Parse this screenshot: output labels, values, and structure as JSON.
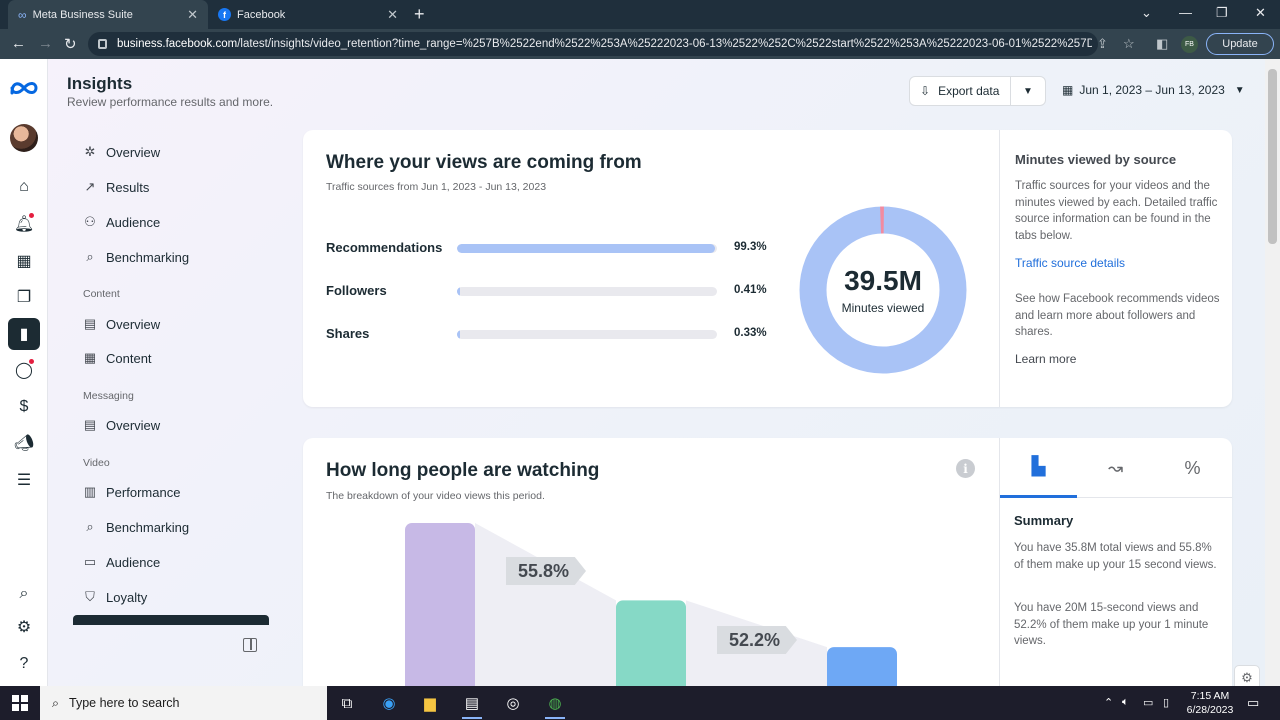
{
  "browser": {
    "tabs": [
      {
        "title": "Meta Business Suite",
        "active": true
      },
      {
        "title": "Facebook",
        "active": false
      }
    ],
    "url_domain": "business.facebook.com",
    "url_path": "/latest/insights/video_retention?time_range=%257B%2522end%2522%253A%25222023-06-13%2522%252C%2522start%2522%253A%25222023-06-01%2522%257D",
    "profile_initials": "FB",
    "update_label": "Update"
  },
  "header": {
    "title": "Insights",
    "subtitle": "Review performance results and more.",
    "export_label": "Export data",
    "date_range": "Jun 1, 2023 – Jun 13, 2023"
  },
  "subnav": {
    "items": [
      {
        "label": "Overview",
        "icon": "network-icon"
      },
      {
        "label": "Results",
        "icon": "trend-icon"
      },
      {
        "label": "Audience",
        "icon": "people-icon"
      },
      {
        "label": "Benchmarking",
        "icon": "benchmark-icon"
      }
    ],
    "content_section": "Content",
    "content_items": [
      {
        "label": "Overview",
        "icon": "overview-icon"
      },
      {
        "label": "Content",
        "icon": "table-icon"
      }
    ],
    "messaging_section": "Messaging",
    "messaging_items": [
      {
        "label": "Overview",
        "icon": "overview-icon"
      }
    ],
    "video_section": "Video",
    "video_items": [
      {
        "label": "Performance",
        "icon": "document-icon"
      },
      {
        "label": "Benchmarking",
        "icon": "benchmark-icon"
      },
      {
        "label": "Audience",
        "icon": "camera-icon"
      },
      {
        "label": "Loyalty",
        "icon": "shield-icon"
      }
    ]
  },
  "views_card": {
    "title": "Where your views are coming from",
    "subtitle": "Traffic sources from Jun 1, 2023 - Jun 13, 2023",
    "sources": [
      {
        "label": "Recommendations",
        "value": 99.3,
        "display": "99.3%"
      },
      {
        "label": "Followers",
        "value": 0.41,
        "display": "0.41%"
      },
      {
        "label": "Shares",
        "value": 0.33,
        "display": "0.33%"
      }
    ],
    "donut_value": "39.5M",
    "donut_label": "Minutes viewed",
    "side_title": "Minutes viewed by source",
    "side_text_1": "Traffic sources for your videos and the minutes viewed by each. Detailed traffic source information can be found in the tabs below.",
    "side_link_1": "Traffic source details",
    "side_text_2": "See how Facebook recommends videos and learn more about followers and shares.",
    "side_link_2": "Learn more",
    "colors": {
      "primary": "#a9c3f6",
      "accent": "#f28ba0"
    }
  },
  "watch_card": {
    "title": "How long people are watching",
    "subtitle": "The breakdown of your video views this period.",
    "bars": [
      {
        "color": "#c7b9e6",
        "value": 100
      },
      {
        "color": "#86d9c6",
        "value": 55.8
      },
      {
        "color": "#6ea8f5",
        "value": 29.1
      }
    ],
    "retention_tags": [
      "55.8%",
      "52.2%"
    ],
    "summary_title": "Summary",
    "summary_1": "You have 35.8M total views and 55.8% of them make up your 15 second views.",
    "summary_2": "You have 20M 15-second views and 52.2% of them make up your 1 minute views."
  },
  "taskbar": {
    "search_placeholder": "Type here to search",
    "time": "7:15 AM",
    "date": "6/28/2023"
  }
}
